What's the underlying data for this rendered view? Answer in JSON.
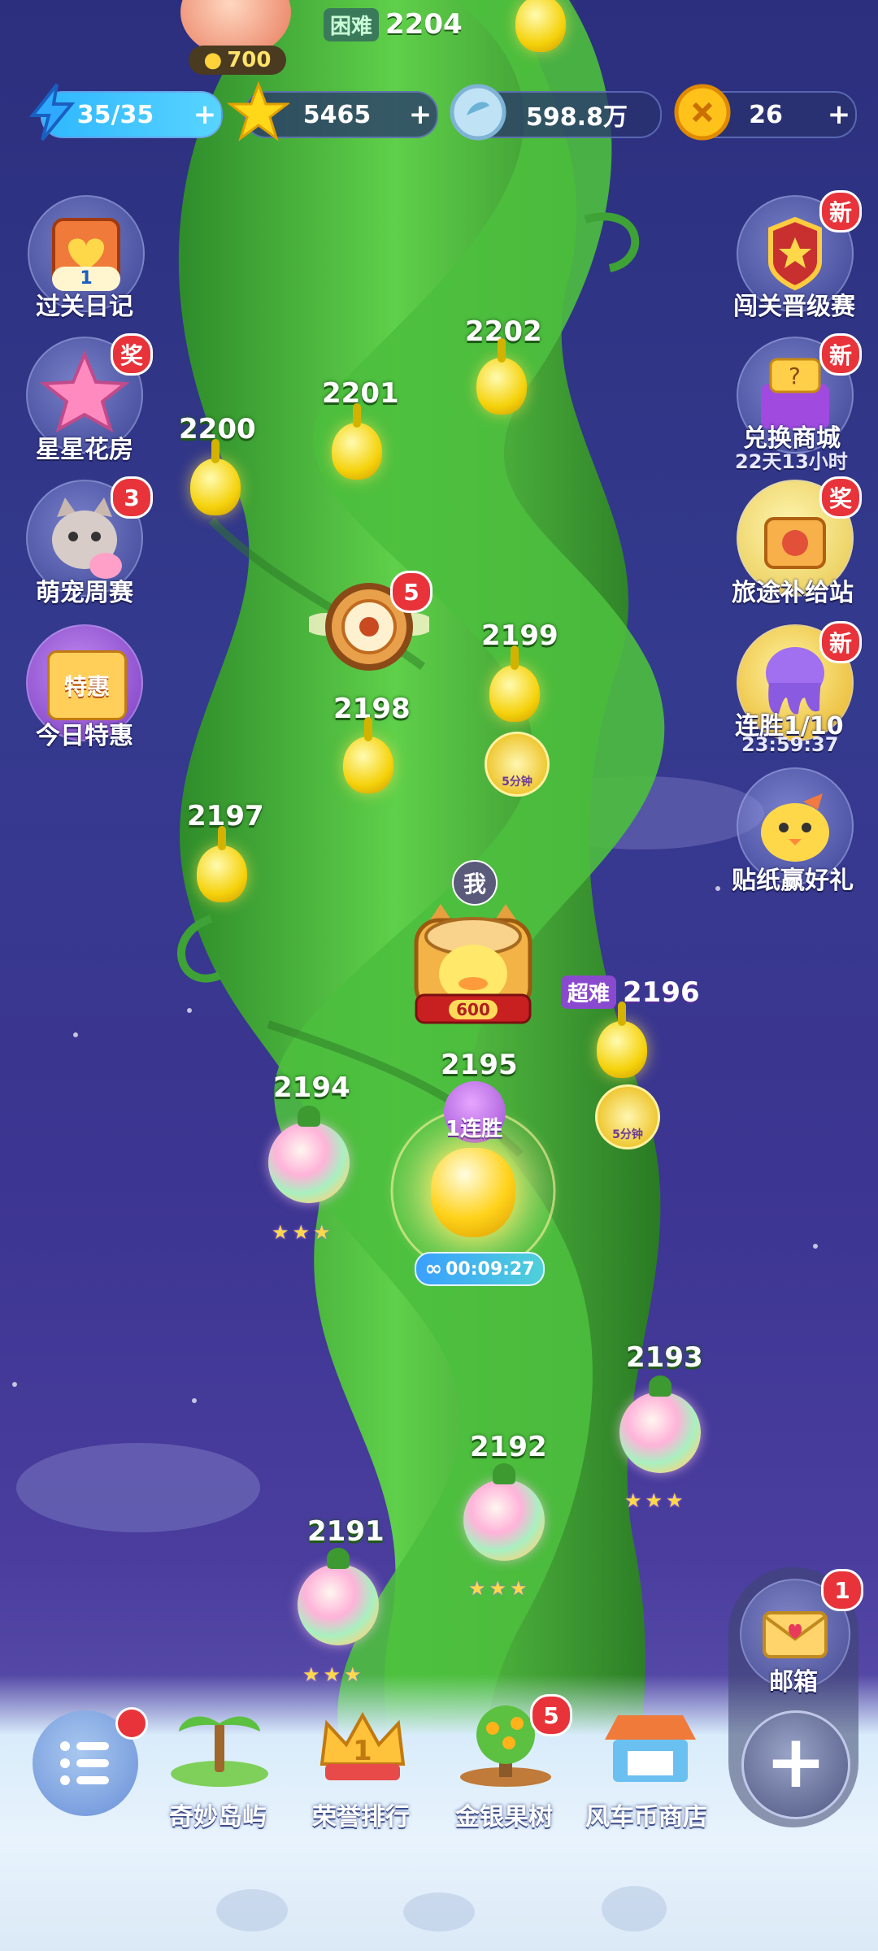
{
  "top_level": {
    "difficulty": "困难",
    "number": "2204",
    "coin_cost": "700"
  },
  "resources": {
    "energy": "35/35",
    "stars": "5465",
    "gems": "598.8万",
    "coins": "26",
    "plus": "+"
  },
  "levels": [
    {
      "num": "2202"
    },
    {
      "num": "2201"
    },
    {
      "num": "2200"
    },
    {
      "num": "2199"
    },
    {
      "num": "2198"
    },
    {
      "num": "2197"
    },
    {
      "num": "2196"
    },
    {
      "num": "2195"
    },
    {
      "num": "2194"
    },
    {
      "num": "2193"
    },
    {
      "num": "2192"
    },
    {
      "num": "2191"
    }
  ],
  "current": {
    "me": "我",
    "coins": "600",
    "streak": "1连胜",
    "timer": "00:09:27",
    "super_hard": "超难",
    "boost": "5分钟"
  },
  "wheel_badge": "5",
  "stars_row": "★★★",
  "left_menu": [
    {
      "label": "过关日记",
      "badge": "",
      "count": "1"
    },
    {
      "label": "星星花房",
      "badge": "奖"
    },
    {
      "label": "萌宠周赛",
      "badge": "3"
    },
    {
      "label": "今日特惠",
      "badge": "",
      "tag": "特惠"
    }
  ],
  "right_menu": [
    {
      "label": "闯关晋级赛",
      "badge": "新"
    },
    {
      "label": "兑换商城",
      "badge": "新",
      "sub": "22天13小时"
    },
    {
      "label": "旅途补给站",
      "badge": "奖"
    },
    {
      "label": "连胜1/10",
      "badge": "新",
      "sub": "23:59:37"
    },
    {
      "label": "贴纸赢好礼",
      "badge": ""
    }
  ],
  "mailbox": {
    "label": "邮箱",
    "badge": "1",
    "plus": "+"
  },
  "bottom_nav": [
    {
      "label": "奇妙岛屿"
    },
    {
      "label": "荣誉排行",
      "rank": "1"
    },
    {
      "label": "金银果树",
      "badge": "5"
    },
    {
      "label": "风车币商店"
    }
  ]
}
